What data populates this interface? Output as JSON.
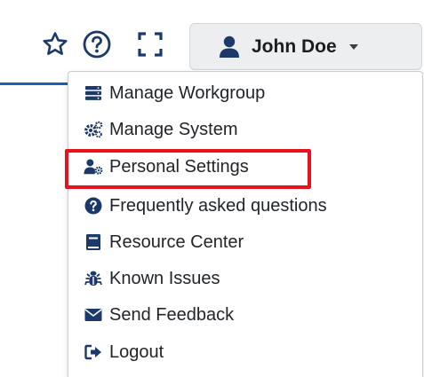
{
  "toolbar": {
    "favorites_icon": "star-outline-icon",
    "help_icon": "question-circle-icon",
    "fullscreen_icon": "fullscreen-icon"
  },
  "user_menu": {
    "name": "John Doe",
    "avatar_icon": "user-icon",
    "caret_icon": "caret-down-icon"
  },
  "dropdown": {
    "items": [
      {
        "label": "Manage Workgroup",
        "icon": "server-stack-icon"
      },
      {
        "label": "Manage System",
        "icon": "gears-icon"
      },
      {
        "label": "Personal Settings",
        "icon": "user-gear-icon"
      },
      {
        "label": "Frequently asked questions",
        "icon": "question-circle-icon"
      },
      {
        "label": "Resource Center",
        "icon": "book-icon"
      },
      {
        "label": "Known Issues",
        "icon": "bug-icon"
      },
      {
        "label": "Send Feedback",
        "icon": "envelope-icon"
      },
      {
        "label": "Logout",
        "icon": "sign-out-icon"
      }
    ],
    "highlighted_item": "Personal Settings",
    "highlight_color": "#e8111d"
  },
  "colors": {
    "icon_blue": "#1b3a6b",
    "accent_blue": "#1a5fb4"
  }
}
